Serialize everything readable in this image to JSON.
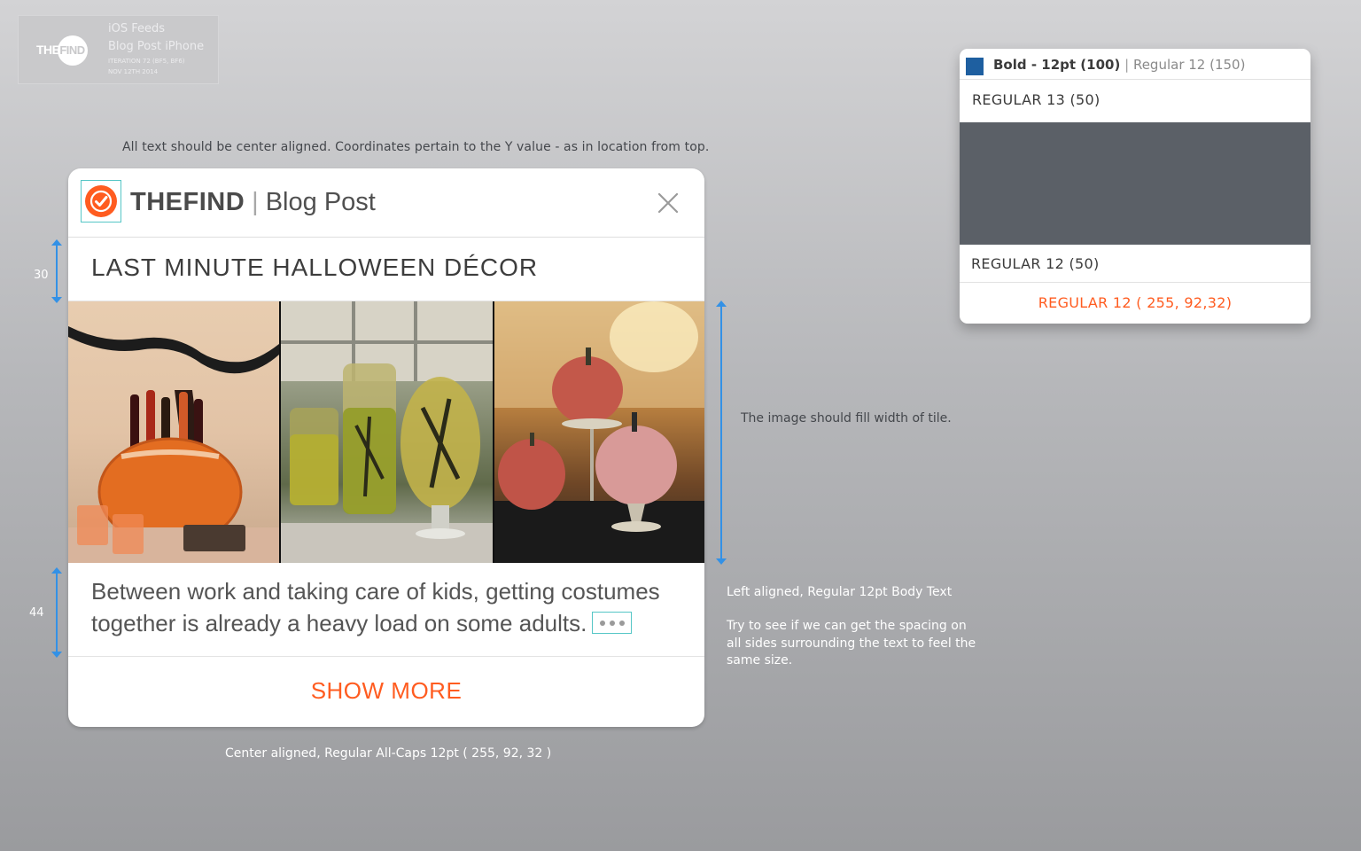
{
  "brand_tag": {
    "logo_left": "THE",
    "logo_right": "FIND",
    "line1": "iOS Feeds",
    "line2": "Blog Post iPhone",
    "line3": "ITERATION 72  (BF5, BF6)",
    "line4": "NOV 12TH 2014"
  },
  "notes": {
    "top": "All text should be center aligned. Coordinates pertain to the Y value - as in location from top.",
    "image": "The image should fill width of tile.",
    "body": "Left aligned, Regular 12pt Body Text",
    "spacing": "Try to see if we can get the spacing on all sides surrounding the text to feel the same size.",
    "cta": "Center aligned, Regular All-Caps 12pt ( 255, 92, 32 )"
  },
  "dimensions": {
    "headline": "30",
    "body": "44"
  },
  "card": {
    "brand_bold": "THEFIND",
    "brand_sep": "|",
    "brand_type": "Blog Post",
    "headline": "LAST MINUTE HALLOWEEN DÉCOR",
    "body": "Between work and taking care of kids, getting costumes together is already a heavy load on some adults.",
    "cta": "SHOW MORE"
  },
  "spec": {
    "head_bold": "Bold - 12pt (100)",
    "head_pipe": "|",
    "head_regular": "Regular 12 (150)",
    "row1": "REGULAR 13 (50)",
    "row2": "REGULAR 12 (50)",
    "row3": "REGULAR 12 ( 255, 92,32)"
  },
  "colors": {
    "accent": "#ff5c20",
    "swatch": "#1e5fa0",
    "annotation_blue": "#3391e6",
    "selection_teal": "#55c6c6"
  },
  "icons": {
    "logo": "check-circle-icon",
    "close": "close-icon",
    "more": "ellipsis-icon"
  }
}
